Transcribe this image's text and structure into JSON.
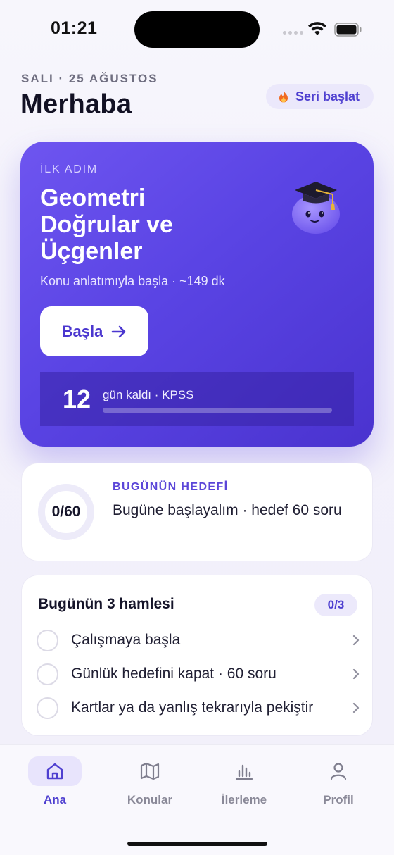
{
  "status_bar": {
    "time": "01:21"
  },
  "header": {
    "date": "SALI · 25 AĞUSTOS",
    "greeting": "Merhaba",
    "streak_label": "Seri başlat",
    "streak_icon": "fire-icon"
  },
  "hero": {
    "kicker": "İLK ADIM",
    "title": "Geometri Doğrular ve Üçgenler",
    "subtitle": "Konu anlatımıyla başla · ~149 dk",
    "start_label": "Başla",
    "days_left": "12",
    "days_label": "gün kaldı · KPSS",
    "days_progress": 0,
    "colors": {
      "card_start": "#6e55f0",
      "card_end": "#4a33cf",
      "accent": "#4e3fd0"
    }
  },
  "goal": {
    "progress_text": "0/60",
    "done": 0,
    "target": 60,
    "kicker": "BUGÜNÜN HEDEFİ",
    "text": "Bugüne başlayalım · hedef 60 soru"
  },
  "moves": {
    "title": "Bugünün 3 hamlesi",
    "badge": "0/3",
    "items": [
      {
        "label": "Çalışmaya başla"
      },
      {
        "label": "Günlük hedefini kapat · 60 soru"
      },
      {
        "label": "Kartlar ya da yanlış tekrarıyla pekiştir"
      }
    ]
  },
  "tabs": [
    {
      "label": "Ana",
      "icon": "home-icon",
      "active": true
    },
    {
      "label": "Konular",
      "icon": "map-icon",
      "active": false
    },
    {
      "label": "İlerleme",
      "icon": "bar-chart-icon",
      "active": false
    },
    {
      "label": "Profil",
      "icon": "user-icon",
      "active": false
    }
  ]
}
